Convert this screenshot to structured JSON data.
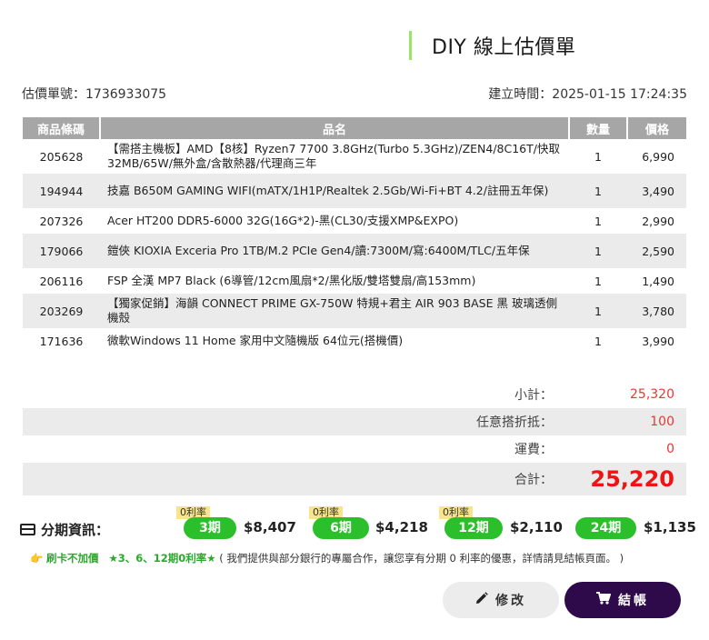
{
  "header": {
    "title": "DIY 線上估價單"
  },
  "meta": {
    "quote_no": "估價單號：1736933075",
    "created": "建立時間：2025-01-15 17:24:35"
  },
  "table": {
    "headers": [
      "商品條碼",
      "品名",
      "數量",
      "價格"
    ],
    "rows": [
      {
        "code": "205628",
        "name": "【需搭主機板】AMD【8核】Ryzen7 7700 3.8GHz(Turbo 5.3GHz)/ZEN4/8C16T/快取32MB/65W/無外盒/含散熱器/代理商三年",
        "qty": "1",
        "price": "6,990"
      },
      {
        "code": "194944",
        "name": "技嘉 B650M GAMING WIFI(mATX/1H1P/Realtek 2.5Gb/Wi-Fi+BT 4.2/註冊五年保)",
        "qty": "1",
        "price": "3,490"
      },
      {
        "code": "207326",
        "name": "Acer HT200 DDR5-6000 32G(16G*2)-黑(CL30/支援XMP&EXPO)",
        "qty": "1",
        "price": "2,990"
      },
      {
        "code": "179066",
        "name": "鎧俠 KIOXIA Exceria Pro 1TB/M.2 PCIe Gen4/讀:7300M/寫:6400M/TLC/五年保",
        "qty": "1",
        "price": "2,590"
      },
      {
        "code": "206116",
        "name": "FSP 全漢 MP7 Black (6導管/12cm風扇*2/黑化版/雙塔雙扇/高153mm)",
        "qty": "1",
        "price": "1,490"
      },
      {
        "code": "203269",
        "name": "【獨家促銷】海韻 CONNECT PRIME GX-750W 特規+君主 AIR 903 BASE 黑 玻璃透側機殼",
        "qty": "1",
        "price": "3,780"
      },
      {
        "code": "171636",
        "name": "微軟Windows 11 Home 家用中文隨機版 64位元(搭機價)",
        "qty": "1",
        "price": "3,990"
      }
    ]
  },
  "summary": {
    "subtotal_label": "小計：",
    "subtotal": "25,320",
    "discount_label": "任意搭折抵：",
    "discount": "100",
    "shipping_label": "運費：",
    "shipping": "0",
    "total_label": "合計：",
    "total": "25,220"
  },
  "installments": {
    "title": "分期資訊：",
    "zero_tag": "0利率",
    "plans": [
      {
        "period": "3期",
        "amount": "$8,407"
      },
      {
        "period": "6期",
        "amount": "$4,218"
      },
      {
        "period": "12期",
        "amount": "$2,110"
      },
      {
        "period": "24期",
        "amount": "$1,135"
      }
    ]
  },
  "note": {
    "hand": "👉",
    "part1": "刷卡不加價",
    "part2": "★3、6、12期0利率★",
    "part3": "( 我們提供與部分銀行的專屬合作，讓您享有分期 0 利率的優惠，詳情請見結帳頁面。 )"
  },
  "buttons": {
    "edit": "修改",
    "checkout": "結帳"
  },
  "colors": {
    "accent": "#2bbf2b",
    "total_red": "#ef1414",
    "checkout_bg": "#2e0a4a",
    "title_bar": "#9be36a"
  }
}
